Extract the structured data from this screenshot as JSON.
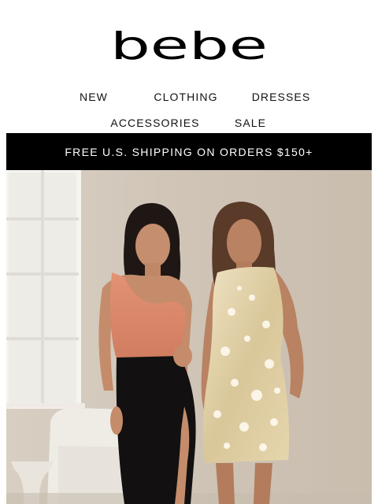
{
  "brand": {
    "logo_text": "bebe"
  },
  "nav": {
    "row1": [
      "NEW",
      "CLOTHING",
      "DRESSES"
    ],
    "row2": [
      "ACCESSORIES",
      "SALE"
    ]
  },
  "promo_banner": {
    "text": "FREE U.S. SHIPPING ON ORDERS $150+"
  },
  "colors": {
    "banner_bg": "#000000",
    "banner_text": "#ffffff"
  },
  "hero": {
    "image": "hero-photo"
  }
}
